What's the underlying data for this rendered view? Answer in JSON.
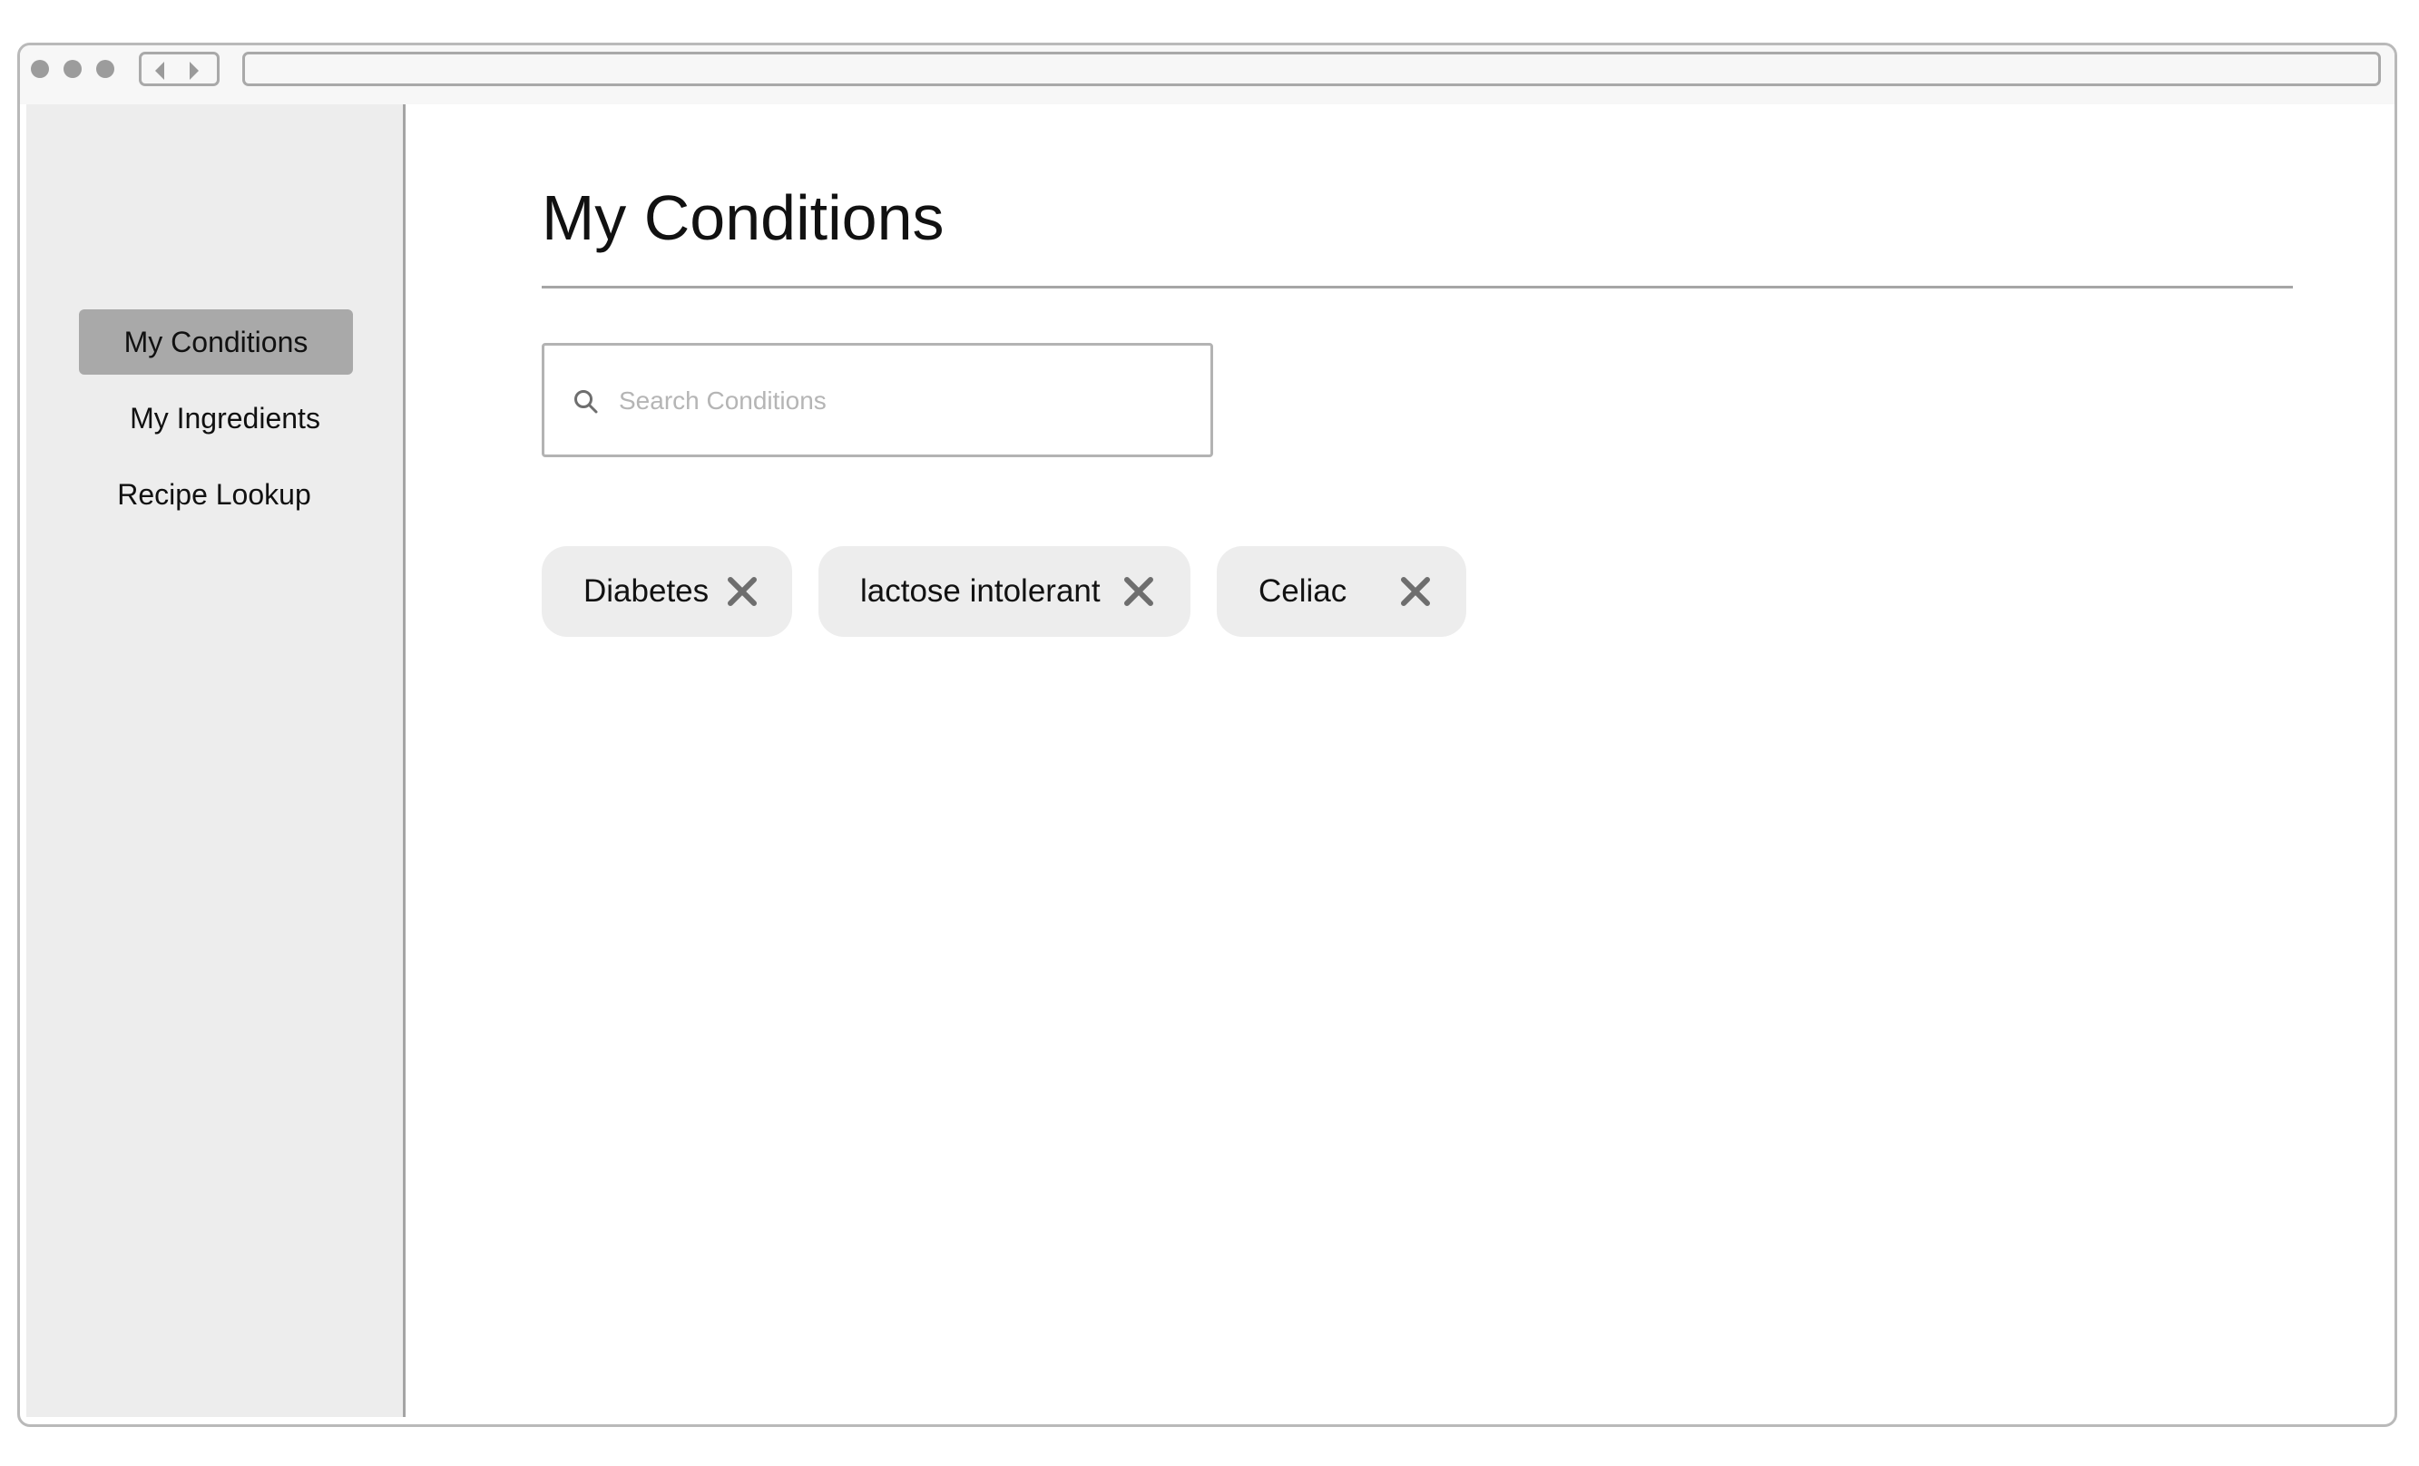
{
  "sidebar": {
    "items": [
      {
        "label": "My Conditions",
        "active": true
      },
      {
        "label": "My Ingredients",
        "active": false
      },
      {
        "label": "Recipe Lookup",
        "active": false
      }
    ]
  },
  "main": {
    "title": "My Conditions",
    "search": {
      "placeholder": "Search Conditions",
      "value": ""
    },
    "conditions": [
      {
        "label": "Diabetes"
      },
      {
        "label": "lactose intolerant"
      },
      {
        "label": "Celiac"
      }
    ]
  },
  "icons": {
    "search": "search-icon",
    "remove": "close-icon",
    "back": "chevron-left-icon",
    "forward": "chevron-right-icon"
  },
  "colors": {
    "active_nav": "#a9a9a9",
    "sidebar_bg": "#ededed",
    "chip_bg": "#ededed",
    "close_icon": "#6e6e6e"
  }
}
